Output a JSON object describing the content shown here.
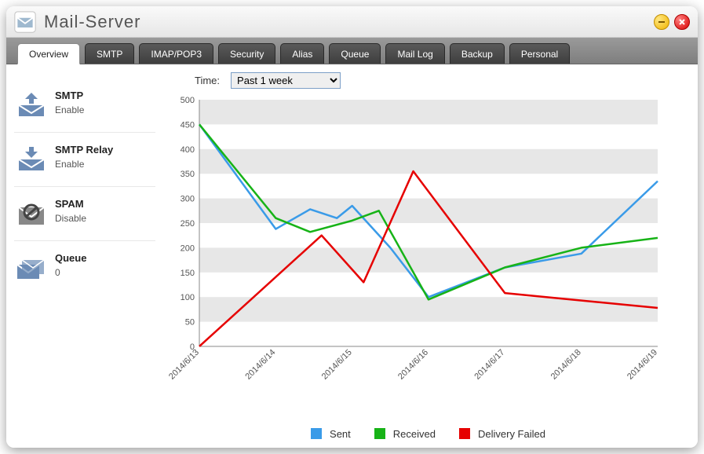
{
  "window": {
    "title": "Mail-Server"
  },
  "tabs": [
    "Overview",
    "SMTP",
    "IMAP/POP3",
    "Security",
    "Alias",
    "Queue",
    "Mail Log",
    "Backup",
    "Personal"
  ],
  "active_tab": 0,
  "sidebar": [
    {
      "title": "SMTP",
      "value": "Enable",
      "icon": "mail-send"
    },
    {
      "title": "SMTP Relay",
      "value": "Enable",
      "icon": "mail-receive"
    },
    {
      "title": "SPAM",
      "value": "Disable",
      "icon": "mail-spam"
    },
    {
      "title": "Queue",
      "value": "0",
      "icon": "mail-queue"
    }
  ],
  "filter": {
    "label": "Time:",
    "value": "Past 1 week"
  },
  "chart_data": {
    "type": "line",
    "title": "",
    "xlabel": "",
    "ylabel": "",
    "ylim": [
      0,
      500
    ],
    "yticks": [
      0,
      50,
      100,
      150,
      200,
      250,
      300,
      350,
      400,
      450,
      500
    ],
    "categories": [
      "2014/6/13",
      "2014/6/14",
      "2014/6/15",
      "2014/6/16",
      "2014/6/17",
      "2014/6/18",
      "2014/6/19"
    ],
    "series": [
      {
        "name": "Sent",
        "color": "#3a9be8",
        "x": [
          0,
          1,
          1.45,
          1.8,
          2,
          2.5,
          3,
          4,
          5,
          6
        ],
        "y": [
          450,
          238,
          278,
          260,
          285,
          200,
          100,
          160,
          188,
          335
        ]
      },
      {
        "name": "Received",
        "color": "#17b317",
        "x": [
          0,
          1,
          1.45,
          2,
          2.35,
          3,
          4,
          5,
          6
        ],
        "y": [
          450,
          260,
          232,
          255,
          275,
          95,
          160,
          200,
          220
        ]
      },
      {
        "name": "Delivery Failed",
        "color": "#e60000",
        "x": [
          0,
          1.6,
          2.15,
          2.8,
          4,
          6
        ],
        "y": [
          0,
          225,
          130,
          355,
          108,
          78
        ]
      }
    ],
    "legend_position": "bottom"
  }
}
